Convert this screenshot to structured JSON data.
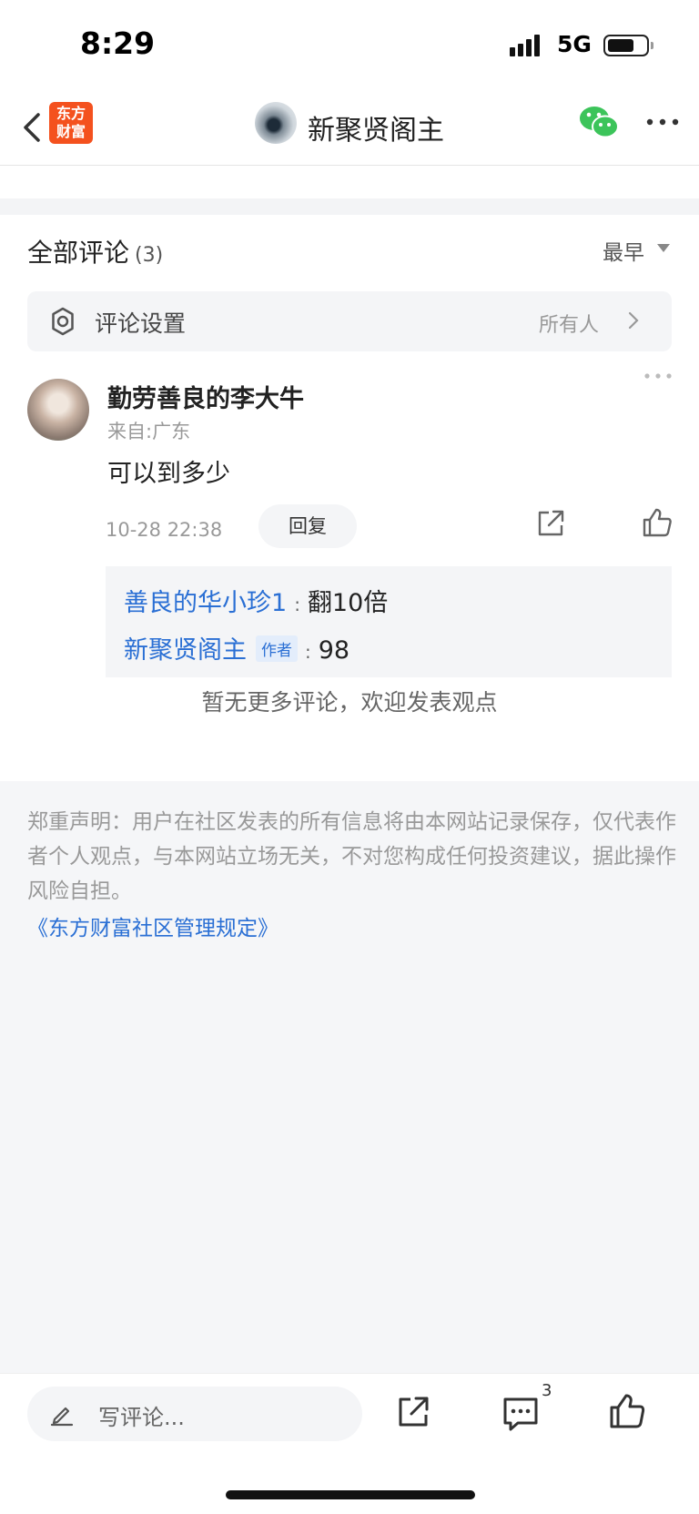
{
  "status_bar": {
    "time": "8:29",
    "network": "5G"
  },
  "nav": {
    "logo_line1": "东方",
    "logo_line2": "财富",
    "title": "新聚贤阁主"
  },
  "comments_header": {
    "title": "全部评论",
    "count": "(3)",
    "sort": "最早"
  },
  "settings": {
    "label": "评论设置",
    "value": "所有人"
  },
  "comment": {
    "user": "勤劳善良的李大牛",
    "location": "来自:广东",
    "text": "可以到多少",
    "time": "10-28 22:38",
    "reply_label": "回复"
  },
  "replies": [
    {
      "user": "善良的华小珍1",
      "separator": ":",
      "text": "翻10倍"
    },
    {
      "user": "新聚贤阁主",
      "badge": "作者",
      "separator": ":",
      "text": "98"
    }
  ],
  "no_more": "暂无更多评论，欢迎发表观点",
  "disclaimer": "郑重声明：用户在社区发表的所有信息将由本网站记录保存，仅代表作者个人观点，与本网站立场无关，不对您构成任何投资建议，据此操作风险自担。",
  "rules_link": "《东方财富社区管理规定》",
  "bottom_bar": {
    "placeholder": "写评论...",
    "comment_count": "3"
  },
  "colors": {
    "link_blue": "#2a6fd4",
    "logo_orange": "#f4511e",
    "wechat_green": "#3cc45a"
  }
}
